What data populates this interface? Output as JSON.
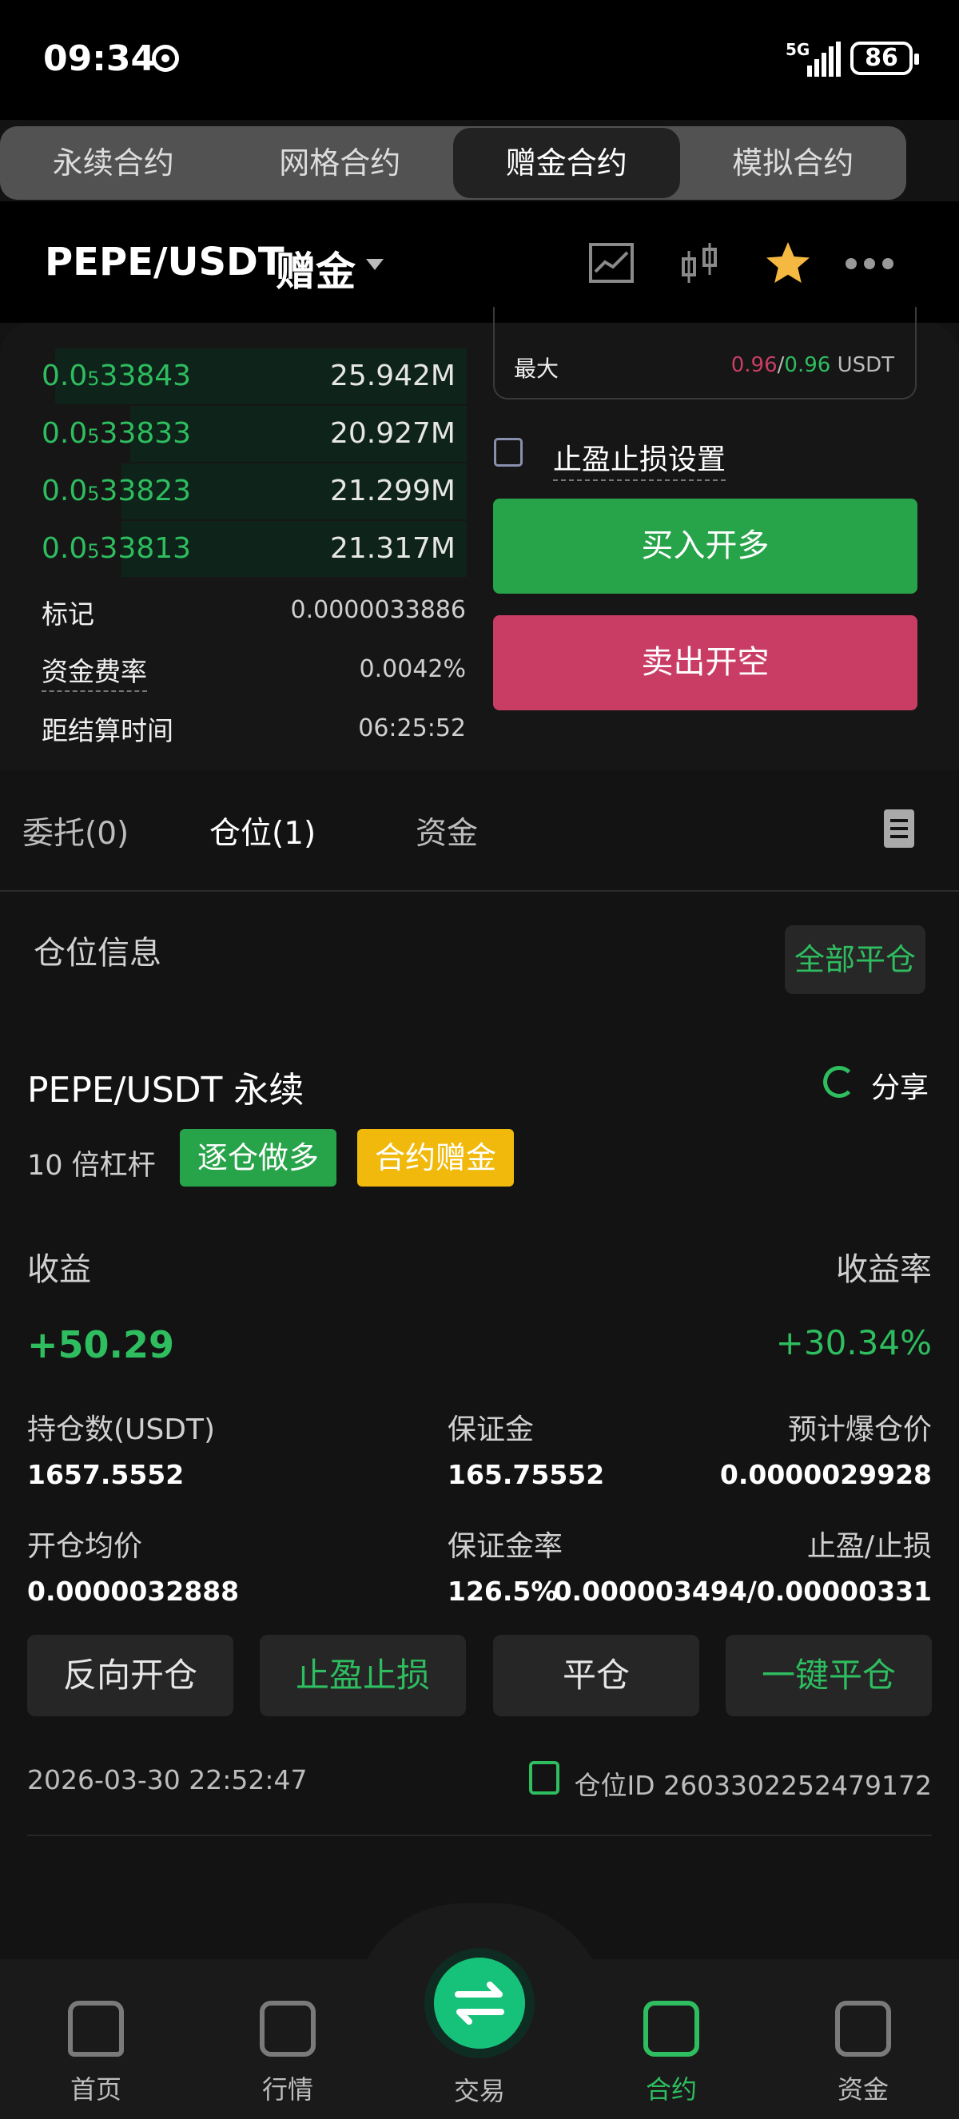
{
  "status_bar": {
    "time": "09:34",
    "network": "5G",
    "battery": "86"
  },
  "tabs": [
    "永续合约",
    "网格合约",
    "赠金合约",
    "模拟合约"
  ],
  "header": {
    "pair": "PEPE/USDT",
    "type": "赠金",
    "icons": [
      "chart-line-icon",
      "candlestick-icon",
      "star-icon",
      "more-icon"
    ]
  },
  "orderbook": {
    "rows": [
      {
        "price_prefix": "0.0",
        "price_sub": "5",
        "price_rest": "33843",
        "qty": "25.942M",
        "depth": 0.93
      },
      {
        "price_prefix": "0.0",
        "price_sub": "5",
        "price_rest": "33833",
        "qty": "20.927M",
        "depth": 0.76
      },
      {
        "price_prefix": "0.0",
        "price_sub": "5",
        "price_rest": "33823",
        "qty": "21.299M",
        "depth": 0.78
      },
      {
        "price_prefix": "0.0",
        "price_sub": "5",
        "price_rest": "33813",
        "qty": "21.317M",
        "depth": 0.78
      }
    ],
    "mark_label": "标记",
    "mark_value": "0.0000033886",
    "funding_label": "资金费率",
    "funding_value": "0.0042%",
    "settle_label": "距结算时间",
    "settle_value": "06:25:52"
  },
  "form": {
    "max_label": "最大",
    "max_buy": "0.96",
    "max_sep": "/",
    "max_sell": "0.96",
    "max_unit": "USDT",
    "tpsl_label": "止盈止损设置",
    "buy_label": "买入开多",
    "sell_label": "卖出开空"
  },
  "sub_tabs": [
    "委托(0)",
    "仓位(1)",
    "资金"
  ],
  "position": {
    "section_title": "仓位信息",
    "close_all": "全部平仓",
    "name": "PEPE/USDT 永续",
    "share": "分享",
    "leverage": "10 倍杠杆",
    "tag1": "逐仓做多",
    "tag2": "合约赠金",
    "pnl_label": "收益",
    "pnl_rate_label": "收益率",
    "pnl": "+50.29",
    "pnl_rate": "+30.34%",
    "grid": [
      {
        "label": "持仓数(USDT)",
        "value": "1657.5552"
      },
      {
        "label": "保证金",
        "value": "165.75552"
      },
      {
        "label": "预计爆仓价",
        "value": "0.0000029928"
      },
      {
        "label": "开仓均价",
        "value": "0.0000032888"
      },
      {
        "label": "保证金率",
        "value": "126.5%"
      },
      {
        "label": "止盈/止损",
        "value": "0.000003494/0.00000331"
      }
    ],
    "actions": [
      "反向开仓",
      "止盈止损",
      "平仓",
      "一键平仓"
    ],
    "timestamp": "2026-03-30 22:52:47",
    "position_id": "仓位ID 2603302252479172"
  },
  "nav": [
    {
      "label": "首页",
      "icon": "home-icon"
    },
    {
      "label": "行情",
      "icon": "market-icon"
    },
    {
      "label": "交易",
      "icon": "swap-icon"
    },
    {
      "label": "合约",
      "icon": "contract-icon"
    },
    {
      "label": "资金",
      "icon": "wallet-icon"
    }
  ],
  "colors": {
    "green": "#2ebd5f",
    "red": "#c93d65",
    "yellow": "#f0b90b",
    "bg": "#131313"
  }
}
